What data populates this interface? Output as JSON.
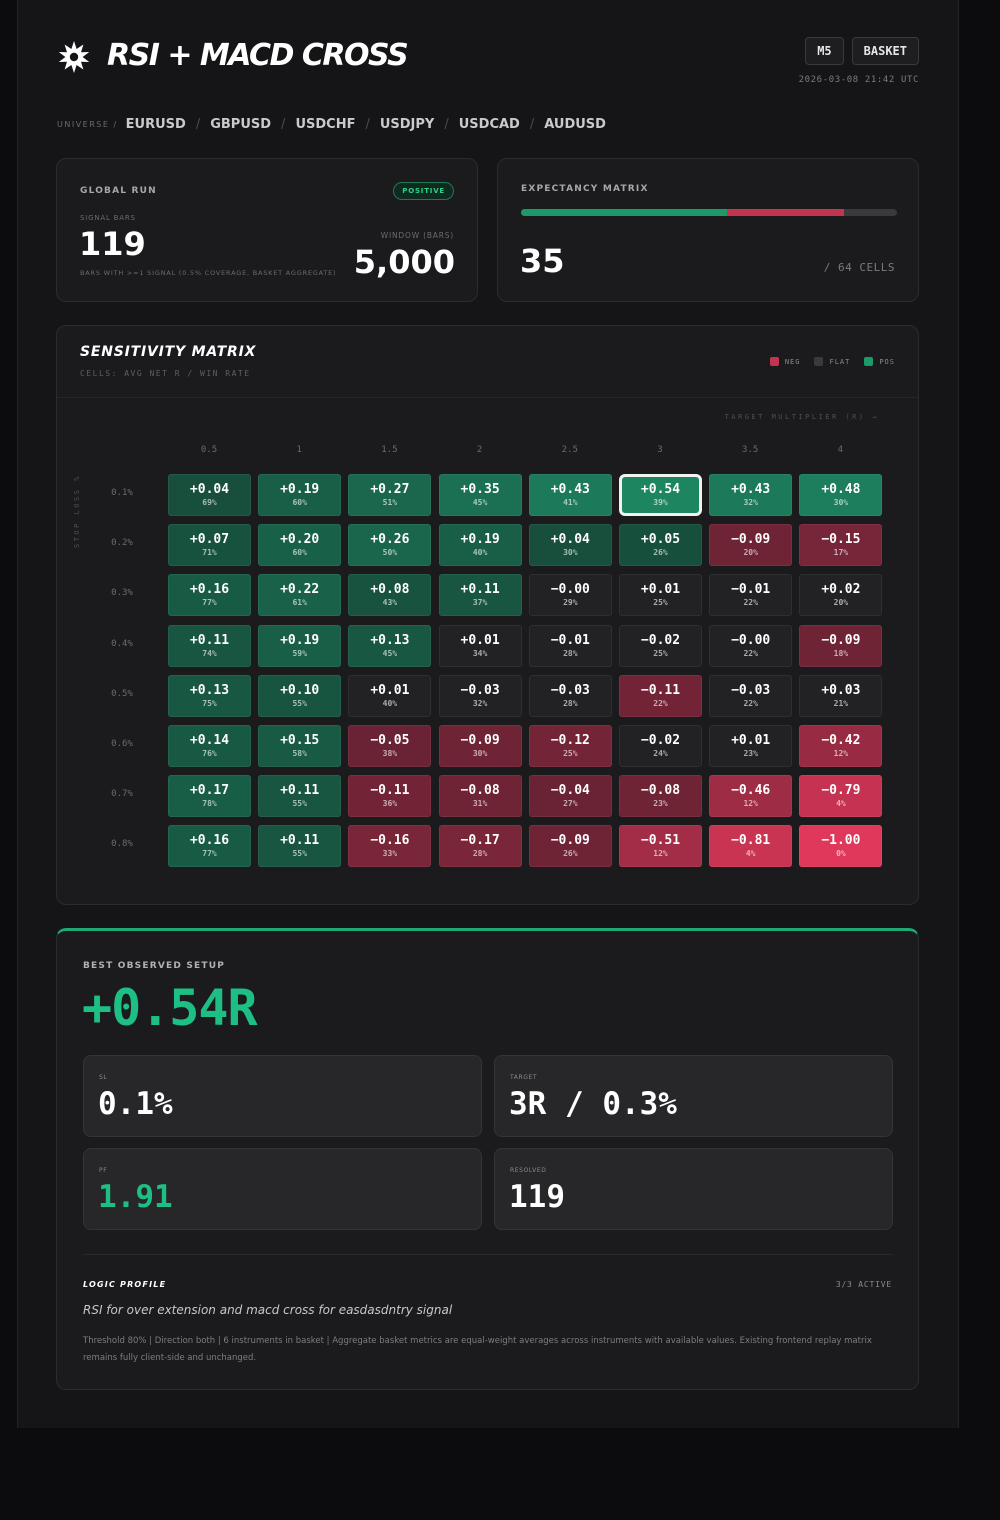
{
  "header": {
    "logo_icon": "starburst-icon",
    "title": "RSI + MACD CROSS",
    "timeframe": "M5",
    "mode": "BASKET",
    "timestamp": "2026-03-08 21:42 UTC"
  },
  "universe": {
    "label": "UNIVERSE /",
    "items": [
      "EURUSD",
      "GBPUSD",
      "USDCHF",
      "USDJPY",
      "USDCAD",
      "AUDUSD"
    ]
  },
  "global_run": {
    "label": "GLOBAL RUN",
    "badge": "POSITIVE",
    "signal_label": "SIGNAL BARS",
    "signal_value": "119",
    "signal_note": "BARS WITH >=1 SIGNAL (0.5% COVERAGE, BASKET AGGREGATE)",
    "window_label": "WINDOW (BARS)",
    "window_value": "5,000"
  },
  "expectancy": {
    "label": "EXPECTANCY MATRIX",
    "positive_cells": 35,
    "negative_cells": 20,
    "total_cells": 64,
    "value": "35",
    "suffix": "/ 64 CELLS",
    "colors": {
      "positive": "#1c9a6a",
      "negative": "#c2344f",
      "rest": "#3a3a3e"
    }
  },
  "matrix": {
    "title": "SENSITIVITY MATRIX",
    "subtitle": "CELLS: AVG NET R / WIN RATE",
    "legend": [
      {
        "label": "NEG",
        "color": "#c2344f"
      },
      {
        "label": "FLAT",
        "color": "#3a3a3e"
      },
      {
        "label": "POS",
        "color": "#1c9a6a"
      }
    ],
    "x_title": "TARGET MULTIPLIER (R) →",
    "y_title": "STOP LOSS %",
    "columns": [
      "0.5",
      "1",
      "1.5",
      "2",
      "2.5",
      "3",
      "3.5",
      "4"
    ],
    "rows": [
      "0.1%",
      "0.2%",
      "0.3%",
      "0.4%",
      "0.5%",
      "0.6%",
      "0.7%",
      "0.8%"
    ],
    "best": {
      "row": 0,
      "col": 5
    },
    "values": [
      [
        "+0.04",
        "+0.19",
        "+0.27",
        "+0.35",
        "+0.43",
        "+0.54",
        "+0.43",
        "+0.48"
      ],
      [
        "+0.07",
        "+0.20",
        "+0.26",
        "+0.19",
        "+0.04",
        "+0.05",
        "−0.09",
        "−0.15"
      ],
      [
        "+0.16",
        "+0.22",
        "+0.08",
        "+0.11",
        "−0.00",
        "+0.01",
        "−0.01",
        "+0.02"
      ],
      [
        "+0.11",
        "+0.19",
        "+0.13",
        "+0.01",
        "−0.01",
        "−0.02",
        "−0.00",
        "−0.09"
      ],
      [
        "+0.13",
        "+0.10",
        "+0.01",
        "−0.03",
        "−0.03",
        "−0.11",
        "−0.03",
        "+0.03"
      ],
      [
        "+0.14",
        "+0.15",
        "−0.05",
        "−0.09",
        "−0.12",
        "−0.02",
        "+0.01",
        "−0.42"
      ],
      [
        "+0.17",
        "+0.11",
        "−0.11",
        "−0.08",
        "−0.04",
        "−0.08",
        "−0.46",
        "−0.79"
      ],
      [
        "+0.16",
        "+0.11",
        "−0.16",
        "−0.17",
        "−0.09",
        "−0.51",
        "−0.81",
        "−1.00"
      ]
    ],
    "win_rates": [
      [
        "69%",
        "60%",
        "51%",
        "45%",
        "41%",
        "39%",
        "32%",
        "30%"
      ],
      [
        "71%",
        "60%",
        "50%",
        "40%",
        "30%",
        "26%",
        "20%",
        "17%"
      ],
      [
        "77%",
        "61%",
        "43%",
        "37%",
        "29%",
        "25%",
        "22%",
        "20%"
      ],
      [
        "74%",
        "59%",
        "45%",
        "34%",
        "28%",
        "25%",
        "22%",
        "18%"
      ],
      [
        "75%",
        "55%",
        "40%",
        "32%",
        "28%",
        "22%",
        "22%",
        "21%"
      ],
      [
        "76%",
        "58%",
        "38%",
        "30%",
        "25%",
        "24%",
        "23%",
        "12%"
      ],
      [
        "78%",
        "55%",
        "36%",
        "31%",
        "27%",
        "23%",
        "12%",
        "4%"
      ],
      [
        "77%",
        "55%",
        "33%",
        "28%",
        "26%",
        "12%",
        "4%",
        "0%"
      ]
    ]
  },
  "best_setup": {
    "label": "BEST OBSERVED SETUP",
    "value": "+0.54R",
    "accent": "#1ebf84",
    "stats": [
      {
        "label": "SL",
        "value": "0.1%"
      },
      {
        "label": "TARGET",
        "value": "3R / 0.3%"
      },
      {
        "label": "PF",
        "value": "1.91"
      },
      {
        "label": "RESOLVED",
        "value": "119"
      }
    ]
  },
  "logic": {
    "title": "LOGIC PROFILE",
    "active": "3/3 ACTIVE",
    "description": "RSI for over extension and macd cross for easdasdntry signal",
    "note": "Threshold 80% | Direction both | 6 instruments in basket | Aggregate basket metrics are equal-weight averages across instruments with available values. Existing frontend replay matrix remains fully client-side and unchanged."
  }
}
